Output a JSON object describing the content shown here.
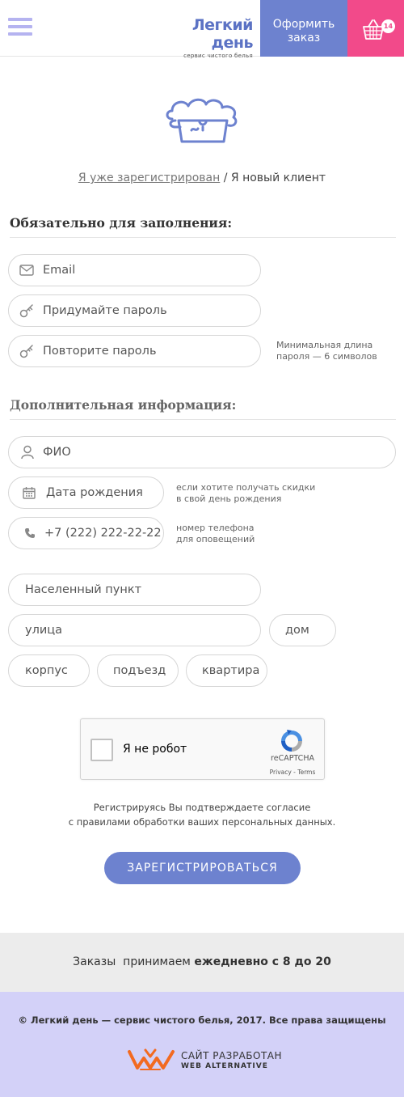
{
  "header": {
    "logo_main": "Легкий день",
    "logo_sub": "сервис чистого белья",
    "order_label_1": "Оформить",
    "order_label_2": "заказ",
    "cart_count": "14",
    "colors": {
      "order": "#6d82cf",
      "cart": "#f24a8a",
      "menu": "#b5b3f0"
    }
  },
  "tabs": {
    "registered": "Я уже зарегистрирован",
    "separator": " / ",
    "new_client": "Я новый клиент"
  },
  "required": {
    "title": "Обязательно для заполнения:",
    "email_placeholder": "Email",
    "password_placeholder": "Придумайте пароль",
    "repeat_placeholder": "Повторите пароль",
    "password_hint_1": "Минимальная длина",
    "password_hint_2": "пароля — 6 символов"
  },
  "extra": {
    "title": "Дополнительная информация:",
    "name_placeholder": "ФИО",
    "birthday_placeholder": "Дата рождения",
    "birthday_hint_1": "если хотите получать скидки",
    "birthday_hint_2": "в свой день рождения",
    "phone_placeholder": "+7 (222) 222-22-22",
    "phone_hint_1": "номер телефона",
    "phone_hint_2": "для оповещений",
    "city_placeholder": "Населенный пункт",
    "street_placeholder": "улица",
    "house_placeholder": "дом",
    "building_placeholder": "корпус",
    "entrance_placeholder": "подъезд",
    "apartment_placeholder": "квартира"
  },
  "captcha": {
    "label": "Я не робот",
    "brand": "reCAPTCHA",
    "links": "Privacy - Terms"
  },
  "agreement": {
    "line_1": "Регистрируясь Вы подтверждаете согласие",
    "line_2": "с правилами обработки ваших персональных данных."
  },
  "submit_label": "ЗАРЕГИСТРИРОВАТЬСЯ",
  "hours": {
    "prefix": "Заказы  принимаем ",
    "bold": "ежедневно с 8 до 20"
  },
  "footer": {
    "copyright": "© Легкий день — сервис чистого белья, 2017. Все права защищены",
    "dev_line_1": "САЙТ РАЗРАБОТАН",
    "dev_line_2": "WEB ALTERNATIVE",
    "background": "#d3d1f8"
  }
}
